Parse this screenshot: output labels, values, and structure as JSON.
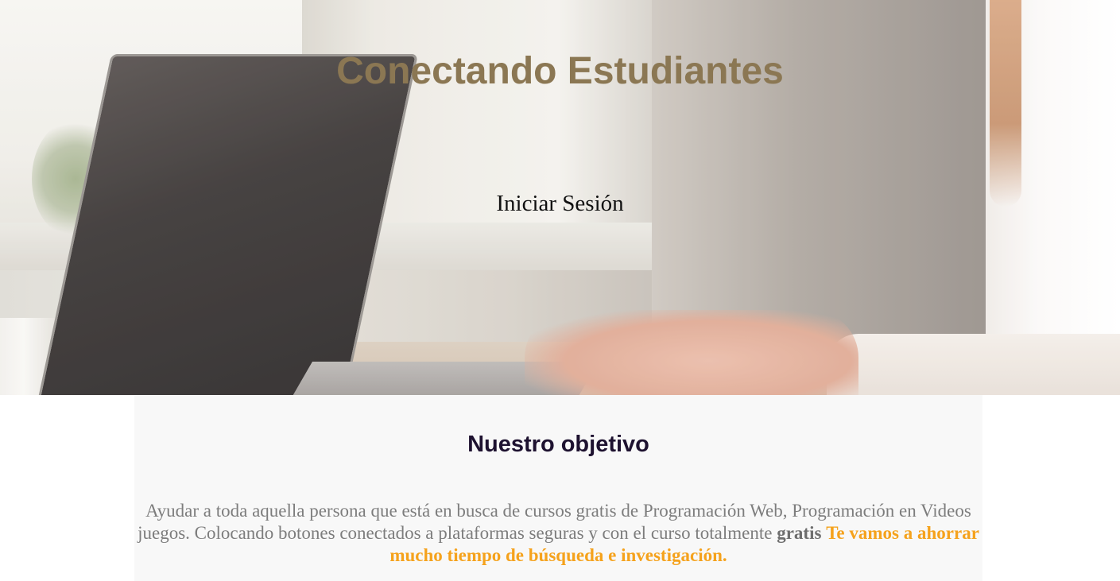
{
  "hero": {
    "title": "Conectando Estudiantes",
    "login_label": "Iniciar Sesión"
  },
  "objective": {
    "heading": "Nuestro objetivo",
    "text": "Ayudar a toda aquella persona que está en busca de cursos gratis de Programación Web, Programación en Videos juegos. Colocando botones conectados a plataformas seguras y con el curso totalmente",
    "free_word": "gratis",
    "highlight": "Te vamos a ahorrar mucho tiempo de búsqueda e investigación."
  },
  "colors": {
    "title": "#8b7753",
    "heading": "#1e1230",
    "body_text": "#7d7d7d",
    "highlight": "#f5a21c",
    "section_bg": "#f8f8f8"
  }
}
